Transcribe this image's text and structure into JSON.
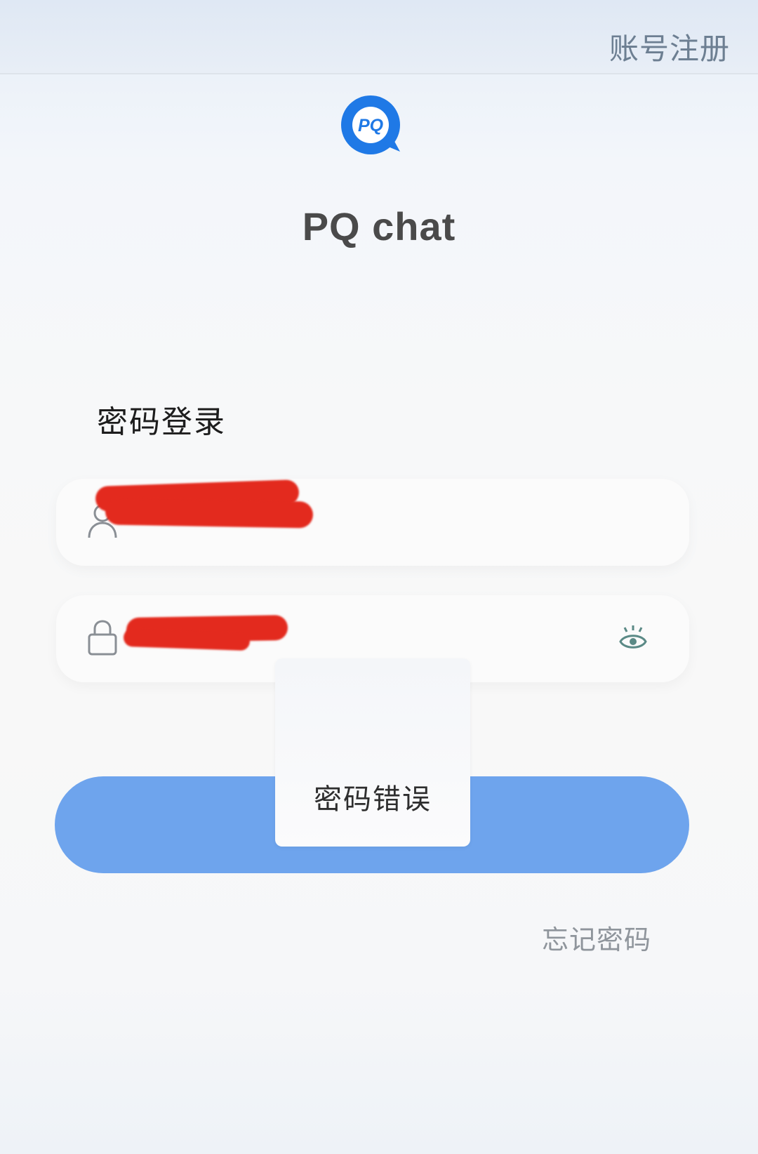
{
  "header": {
    "register_label": "账号注册"
  },
  "app": {
    "name": "PQ chat",
    "logo_text": "PQ",
    "logo_color": "#1f79e6"
  },
  "login": {
    "title": "密码登录",
    "username_value": "",
    "password_value": "",
    "button_label": "",
    "button_color": "#6ea4ed",
    "forgot_label": "忘记密码"
  },
  "toast": {
    "message": "密码错误"
  }
}
